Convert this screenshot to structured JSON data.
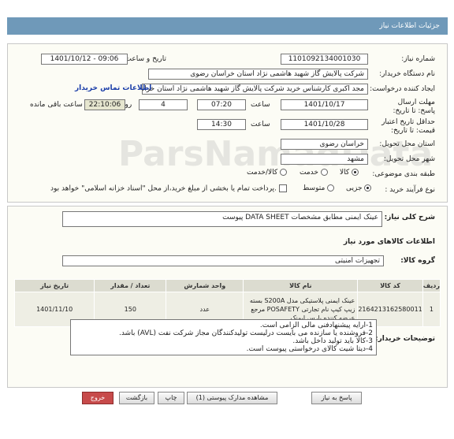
{
  "header": {
    "title": "جزئیات اطلاعات نیاز"
  },
  "watermark": {
    "text": "ParsNamadData",
    "sub": "پایگاه اطلاع رسانی مناقصات"
  },
  "form": {
    "need_number_label": "شماره نیاز:",
    "need_number": "1101092134001030",
    "announce_label": "تاریخ و ساعت اعلان عمومی:",
    "announce_value": "1401/10/12 - 09:06",
    "buyer_org_label": "نام دستگاه خریدار:",
    "buyer_org": "شرکت پالایش گاز شهید هاشمی نژاد   استان خراسان رضوی",
    "creator_label": "ایجاد کننده درخواست:",
    "creator": "مجد اکبری کارشناس خرید شرکت پالایش گاز شهید هاشمی نژاد   استان خراس",
    "contact_link": "اطلاعات تماس خریدار",
    "deadline_label": "مهلت ارسال پاسخ: تا تاریخ:",
    "deadline_date": "1401/10/17",
    "time_label": "ساعت",
    "deadline_time": "07:20",
    "days_value": "4",
    "days_label": "روز و",
    "remaining_time": "22:10:06",
    "remaining_label": "ساعت باقی مانده",
    "validity_label": "حداقل تاریخ اعتبار قیمت: تا تاریخ:",
    "validity_date": "1401/10/28",
    "validity_time": "14:30",
    "province_label": "استان محل تحویل:",
    "province": "خراسان رضوی",
    "city_label": "شهر محل تحویل:",
    "city": "مشهد",
    "category_label": "طبقه بندی موضوعی:",
    "category_options": [
      "کالا",
      "خدمت",
      "کالا/خدمت"
    ],
    "process_label": "نوع فرآیند خرید :",
    "process_options": [
      "جزیی",
      "متوسط"
    ],
    "payment_note": "پرداخت تمام یا بخشی از مبلغ خرید،از محل \"اسناد خزانه اسلامی\" خواهد بود."
  },
  "summary": {
    "label": "شرح کلی نیاز:",
    "value": "عینک ایمنی مطابق مشخصات DATA SHEET پیوست"
  },
  "goods": {
    "section_title": "اطلاعات کالاهای مورد نیاز",
    "group_label": "گروه کالا:",
    "group_value": "تجهیزات امنیتی",
    "columns": [
      "ردیف",
      "کد کالا",
      "نام کالا",
      "واحد شمارش",
      "تعداد / مقدار",
      "تاریخ نیاز"
    ],
    "rows": [
      {
        "row": "1",
        "code": "2164213162580011",
        "name": "عینک ایمنی پلاستیکی مدل S200A بسته زیپ کیپ نام تجارتی POSAFETY مرجع عرضه کننده پارس ایمنک",
        "unit": "عدد",
        "qty": "150",
        "date": "1401/11/10"
      }
    ]
  },
  "notes": {
    "label": "توضیحات خریدار:",
    "lines": [
      "1-ارایه پیشنهادفنی مالی الزامی است.",
      "2-فروشنده یا سازنده می بایست درلیست تولیدکنندگان مجاز شرکت نفت (AVL)  باشد.",
      "3-کالا باید تولید داخل باشد.",
      "4-دیتا شیت کالای درخواستی پیوست است."
    ]
  },
  "buttons": {
    "reply": "پاسخ به نیاز",
    "attachments": "مشاهده مدارک پیوستی (1)",
    "print": "چاپ",
    "back": "بازگشت",
    "exit": "خروج"
  }
}
